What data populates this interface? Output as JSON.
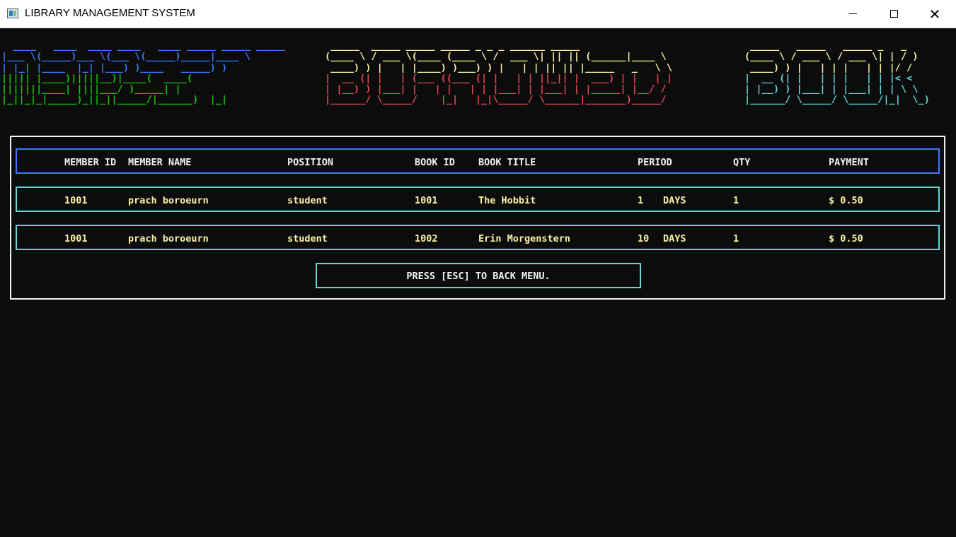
{
  "window": {
    "title": "LIBRARY MANAGEMENT SYSTEM",
    "icon": "console-app-icon",
    "controls": [
      "minimize-icon",
      "maximize-icon",
      "close-icon"
    ],
    "close_glyph": "✕"
  },
  "banner": {
    "words": [
      "MEMBER",
      "BORROWED",
      "BOOK"
    ],
    "colors": {
      "blue": "#3b78ff",
      "green": "#16c60c",
      "yellow": "#f9f1a5",
      "red": "#e74856",
      "cyan": "#61d6d6"
    },
    "member_top": "  ____   ____  ____ ____   ____ _____ _____ _____ \n|___ \\(_____)___ \\(___ \\(_____)_____|____ \\\n| |_| |____  |_| |___) )____   _____) )",
    "member_bottom": "||||| |____)|||||__)|____(  ____(\n|||||||____| ||||___/ )_____| |\n|_||_|_|_____)_||_||_____/|______)  |_|",
    "borrowed_top": " _____  _____ _____ _____ _ _ _ ______ _____ \n(____ \\ / ___ \\(____ (____ \\ /  ___ \\| || || (______|____ \\\n ____) ) |   | |____) )___) ) |   | | || || |_____   _   \\ \\",
    "borrowed_bottom": "|  __ (| |   | (___ ((___ (| |   | | ||_|| |  ___) | |   | |\n| |__) ) |___| |   | |   | | |___| | |___| | |_____| |__/ /\n|______/ \\_____/    |_|   |_|\\_____/ \\______|_______)_____/",
    "book_top": " _____   _____   _____ _   _\n(____ \\ / ___ \\ / ___ \\| | / )\n ____) ) |   | | |   | | |/ /",
    "book_bottom": "|  __ (| |   | | |   | | |< <\n| |__) ) |___| | |___| | | \\ \\\n|______/ \\_____/ \\_____/|_|  \\_)"
  },
  "table": {
    "headers": [
      "MEMBER ID",
      "MEMBER NAME",
      "POSITION",
      "BOOK ID",
      "BOOK TITLE",
      "PERIOD",
      "QTY",
      "PAYMENT"
    ],
    "rows": [
      {
        "member_id": "1001",
        "member_name": "prach boroeurn",
        "position": "student",
        "book_id": "1001",
        "book_title": "The Hobbit",
        "period": "1",
        "unit": "DAYS",
        "qty": "1",
        "payment": "$ 0.50"
      },
      {
        "member_id": "1001",
        "member_name": "prach boroeurn",
        "position": "student",
        "book_id": "1002",
        "book_title": "Erin Morgenstern",
        "period": "10",
        "unit": "DAYS",
        "qty": "1",
        "payment": "$ 0.50"
      }
    ]
  },
  "footer": {
    "esc_label": "PRESS [ESC] TO BACK MENU."
  }
}
